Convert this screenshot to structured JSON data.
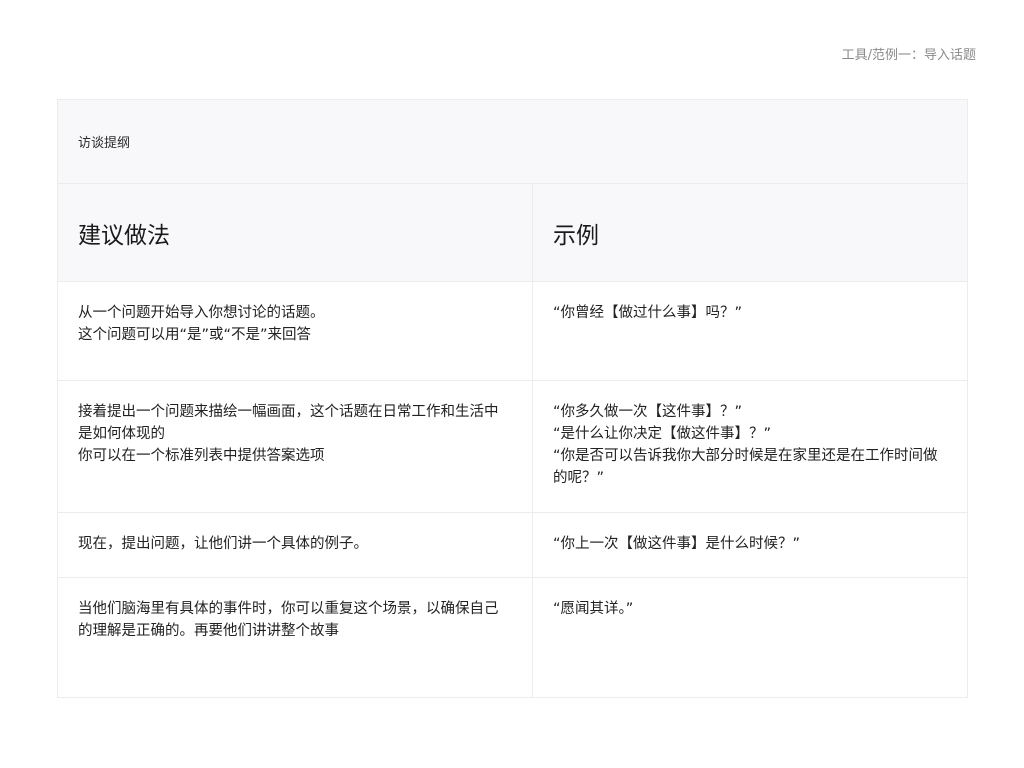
{
  "breadcrumb": "工具/范例一：导入话题",
  "card": {
    "title": "访谈提纲",
    "columns": {
      "practice": "建议做法",
      "example": "示例"
    },
    "rows": [
      {
        "practice": [
          "从一个问题开始导入你想讨论的话题。",
          "这个问题可以用“是”或“不是”来回答"
        ],
        "example": [
          "“你曾经【做过什么事】吗？”"
        ]
      },
      {
        "practice": [
          "接着提出一个问题来描绘一幅画面，这个话题在日常工作和生活中是如何体现的",
          "你可以在一个标准列表中提供答案选项"
        ],
        "example": [
          "“你多久做一次【这件事】？”",
          "“是什么让你决定【做这件事】？”",
          "“你是否可以告诉我你大部分时候是在家里还是在工作时间做的呢？”"
        ]
      },
      {
        "practice": [
          "现在，提出问题，让他们讲一个具体的例子。"
        ],
        "example": [
          "“你上一次【做这件事】是什么时候？”"
        ]
      },
      {
        "practice": [
          "当他们脑海里有具体的事件时，你可以重复这个场景，以确保自己的理解是正确的。再要他们讲讲整个故事"
        ],
        "example": [
          "“愿闻其详。”"
        ]
      }
    ]
  }
}
